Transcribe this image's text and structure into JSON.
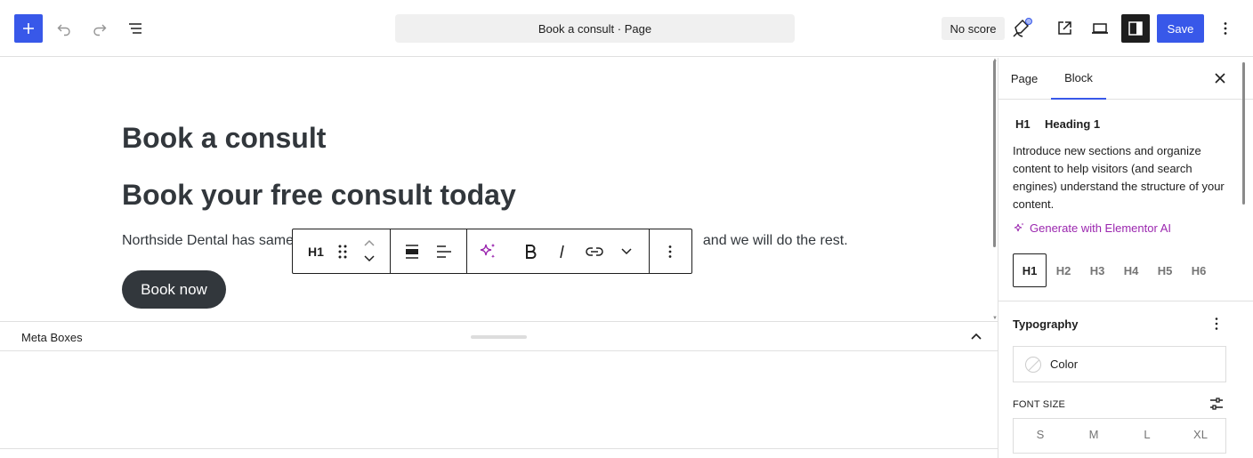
{
  "header": {
    "document_title": "Book a consult · Page",
    "seo_score_label": "No score",
    "save_label": "Save"
  },
  "canvas": {
    "post_title": "Book a consult",
    "heading": "Book your free consult today",
    "paragraph_left": "Northside Dental has same",
    "paragraph_right": "and we will do the rest.",
    "button_label": "Book now"
  },
  "block_toolbar": {
    "block_type_label": "H1",
    "items": [
      "drag-handle",
      "move-up",
      "move-down",
      "align",
      "text-align",
      "ai-assistant",
      "bold",
      "italic",
      "link",
      "more-rich-text",
      "options"
    ]
  },
  "meta_boxes": {
    "label": "Meta Boxes"
  },
  "sidebar": {
    "tabs": [
      "Page",
      "Block"
    ],
    "active_tab": "Block",
    "block_card": {
      "icon_label": "H1",
      "title": "Heading 1",
      "description": "Introduce new sections and organize content to help visitors (and search engines) understand the structure of your content."
    },
    "ai_link_label": "Generate with Elementor AI",
    "heading_levels": [
      "H1",
      "H2",
      "H3",
      "H4",
      "H5",
      "H6"
    ],
    "active_level": "H1",
    "typography": {
      "title": "Typography",
      "color_label": "Color",
      "font_size_label": "FONT SIZE",
      "font_size_options": [
        "S",
        "M",
        "L",
        "XL"
      ]
    }
  },
  "colors": {
    "accent": "#3858e9",
    "ai_purple": "#9b27af",
    "text_dark": "#32373c"
  }
}
